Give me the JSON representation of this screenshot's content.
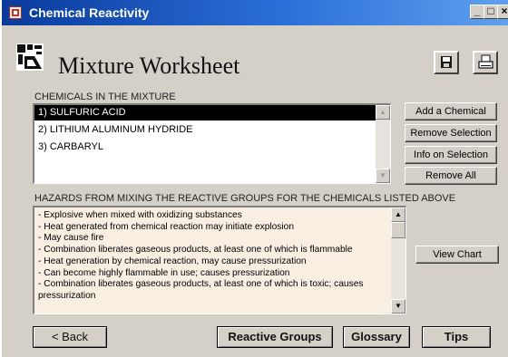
{
  "window": {
    "title": "Chemical Reactivity",
    "minimize_label": "_",
    "maximize_label": "□",
    "close_label": "×"
  },
  "header": {
    "title": "Mixture Worksheet"
  },
  "chemicals": {
    "label": "CHEMICALS IN THE MIXTURE",
    "items": [
      {
        "label": "1) SULFURIC ACID",
        "selected": true
      },
      {
        "label": "2) LITHIUM ALUMINUM HYDRIDE",
        "selected": false
      },
      {
        "label": "3) CARBARYL",
        "selected": false
      }
    ]
  },
  "side_buttons": {
    "add": "Add a Chemical",
    "remove_selection": "Remove Selection",
    "info_on_selection": "Info on Selection",
    "remove_all": "Remove All"
  },
  "hazards": {
    "label": "HAZARDS FROM MIXING THE REACTIVE GROUPS FOR THE CHEMICALS LISTED ABOVE",
    "lines": [
      "- Explosive when mixed with oxidizing substances",
      "- Heat generated from chemical reaction may initiate explosion",
      "- May cause fire",
      "- Combination liberates gaseous products, at least one of which is flammable",
      "- Heat generation by chemical reaction, may cause pressurization",
      "- Can become highly flammable in use; causes pressurization",
      "- Combination liberates gaseous products, at least one of which is toxic; causes pressurization"
    ],
    "view_chart": "View Chart"
  },
  "footer": {
    "back": "< Back",
    "reactive_groups": "Reactive Groups",
    "glossary": "Glossary",
    "tips": "Tips"
  },
  "colors": {
    "titlebar_start": "#0a3a9c",
    "titlebar_end": "#5fa0ee",
    "selection": "#000000",
    "hazard_bg": "#f8efe2",
    "window_bg": "#d4d0c8"
  },
  "icons": {
    "app": "app-icon",
    "logo": "chemical-logo-icon",
    "save": "floppy-disk-icon",
    "print": "printer-icon"
  }
}
